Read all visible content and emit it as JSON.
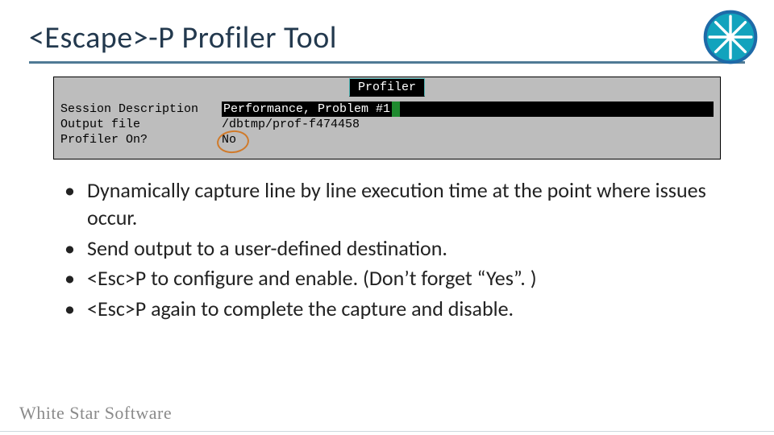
{
  "title": "<Escape>-P  Profiler Tool",
  "terminal": {
    "heading": "Profiler",
    "rows": [
      {
        "label": "Session Description",
        "value": "Performance, Problem #1",
        "highlight": true
      },
      {
        "label": "Output file",
        "value": "/dbtmp/prof-f474458",
        "highlight": false
      },
      {
        "label": "Profiler On?",
        "value": "No",
        "highlight": false,
        "circled": true
      }
    ]
  },
  "bullets": [
    "Dynamically capture line by line execution time at the point where issues occur.",
    "Send output to a user-defined destination.",
    "<Esc>P to configure and enable.  (Don’t forget “Yes”. )",
    "<Esc>P again to complete the capture and disable."
  ],
  "footer_brand": "White Star Software",
  "colors": {
    "title": "#23394e",
    "rule": "#4f7a95",
    "logo_ring": "#1e6aa8",
    "logo_burst": "#ffffff",
    "logo_bg": "#12a3bd"
  }
}
